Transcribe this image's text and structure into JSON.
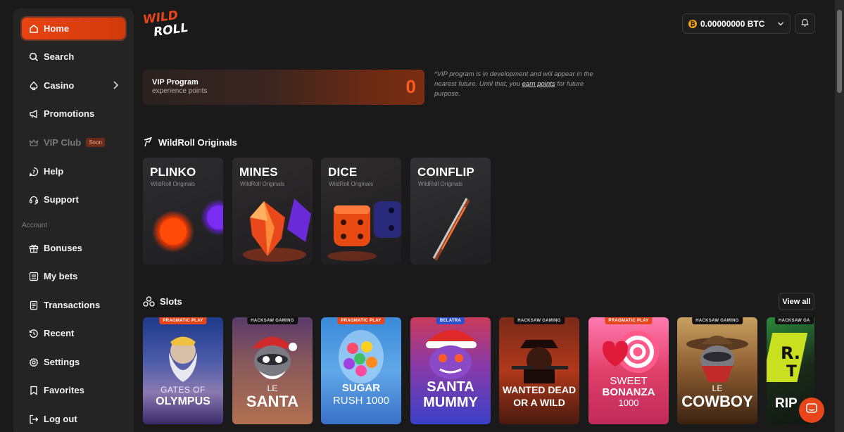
{
  "sidebar": {
    "items": [
      {
        "label": "Home",
        "icon": "home-icon"
      },
      {
        "label": "Search",
        "icon": "search-icon"
      },
      {
        "label": "Casino",
        "icon": "spade-icon"
      },
      {
        "label": "Promotions",
        "icon": "megaphone-icon"
      },
      {
        "label": "VIP Club",
        "icon": "crown-icon",
        "badge": "Soon"
      },
      {
        "label": "Help",
        "icon": "help-icon"
      },
      {
        "label": "Support",
        "icon": "headset-icon"
      }
    ],
    "account_label": "Account",
    "account_items": [
      {
        "label": "Bonuses",
        "icon": "gift-icon"
      },
      {
        "label": "My bets",
        "icon": "list-icon"
      },
      {
        "label": "Transactions",
        "icon": "document-icon"
      },
      {
        "label": "Recent",
        "icon": "history-icon"
      },
      {
        "label": "Settings",
        "icon": "gear-icon"
      },
      {
        "label": "Favorites",
        "icon": "bookmark-icon"
      },
      {
        "label": "Log out",
        "icon": "logout-icon"
      }
    ]
  },
  "header": {
    "logo_line1": "WILD",
    "logo_line2": "ROLL",
    "balance": "0.00000000 BTC",
    "currency_symbol": "₿"
  },
  "vip": {
    "title": "VIP Program",
    "subtitle": "experience points",
    "points": "0",
    "note_before": "*VIP program is in development and will appear in the nearest future. Until that, you ",
    "note_link": "earn points",
    "note_after": " for future purpose."
  },
  "originals": {
    "heading": "WildRoll Originals",
    "games": [
      {
        "title": "PLINKO",
        "subtitle": "WildRoll Originals"
      },
      {
        "title": "MINES",
        "subtitle": "WildRoll Originals"
      },
      {
        "title": "DICE",
        "subtitle": "WildRoll Originals"
      },
      {
        "title": "COINFLIP",
        "subtitle": "WildRoll Originals"
      }
    ]
  },
  "slots": {
    "heading": "Slots",
    "view_all": "View all",
    "games": [
      {
        "provider": "PRAGMATIC PLAY",
        "line1": "GATES OF",
        "line2": "OLYMPUS"
      },
      {
        "provider": "HACKSAW GAMING",
        "line1": "LE",
        "line2": "SANTA"
      },
      {
        "provider": "PRAGMATIC PLAY",
        "line1": "SUGAR",
        "line2": "RUSH 1000"
      },
      {
        "provider": "BELATRA",
        "line1": "SANTA",
        "line2": "MUMMY"
      },
      {
        "provider": "HACKSAW GAMING",
        "line1": "WANTED DEAD",
        "line2": "OR A WILD"
      },
      {
        "provider": "PRAGMATIC PLAY",
        "line1": "SWEET",
        "line2": "BONANZA",
        "line3": "1000"
      },
      {
        "provider": "HACKSAW GAMING",
        "line1": "LE",
        "line2": "COWBOY"
      },
      {
        "provider": "HACKSAW GA",
        "line1": "RIP"
      }
    ]
  },
  "colors": {
    "accent": "#e84312",
    "background": "#1a1a1b",
    "sidebar": "#242425"
  }
}
